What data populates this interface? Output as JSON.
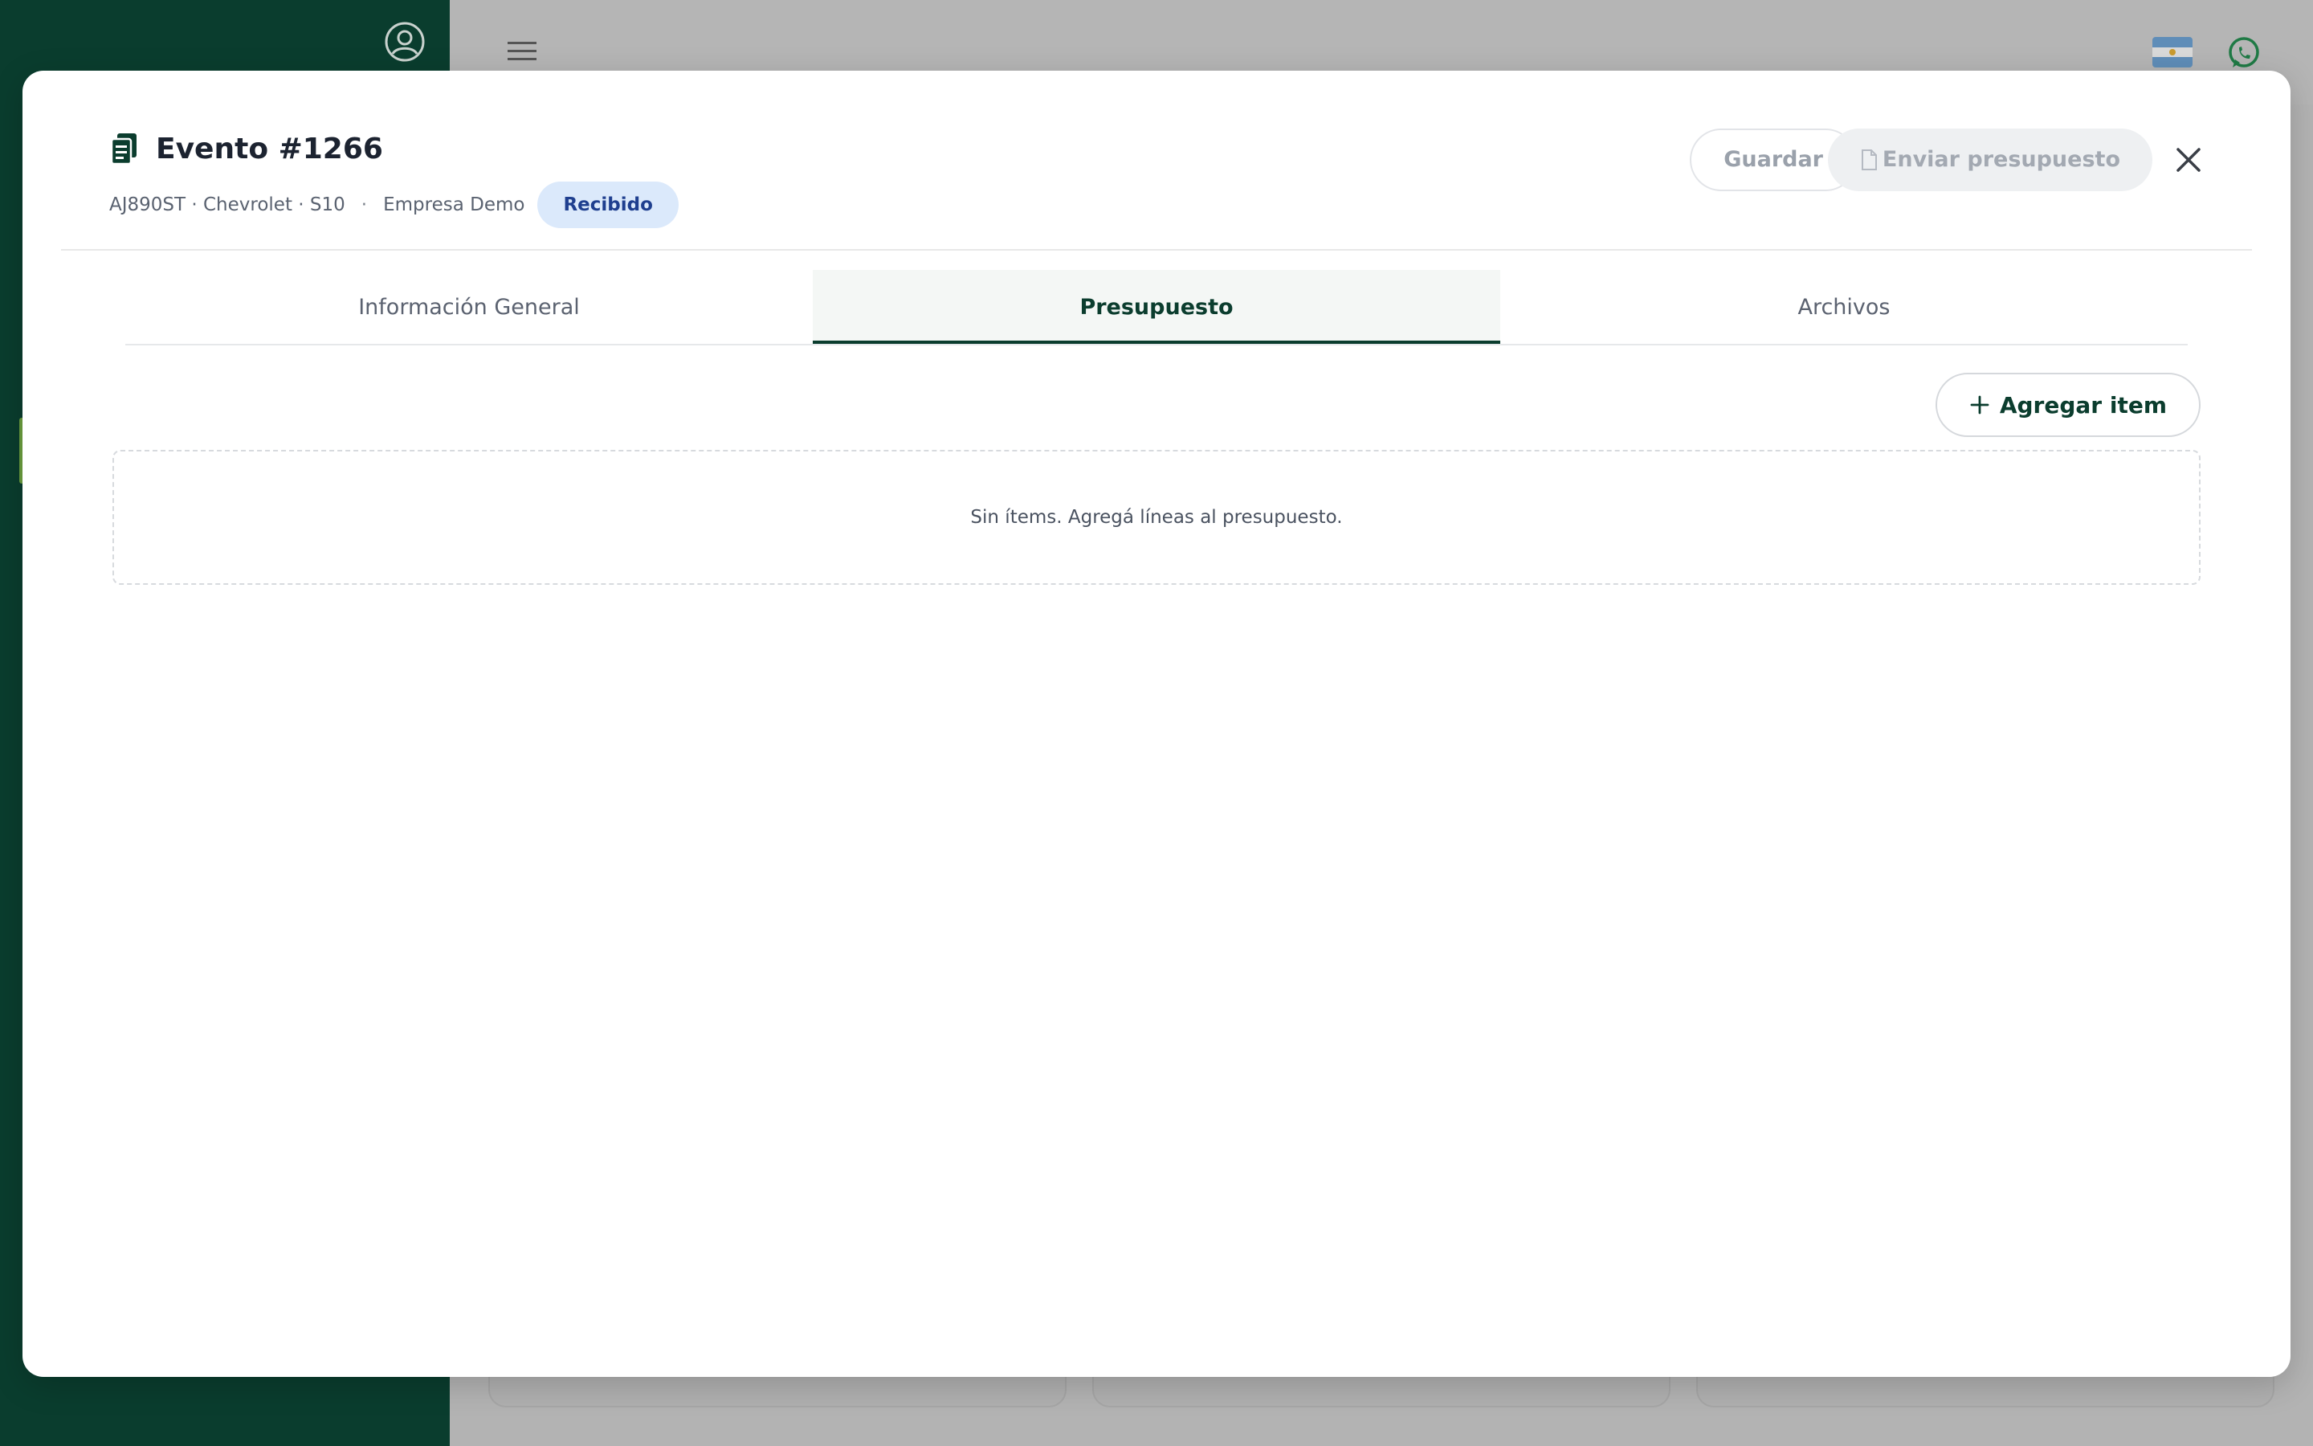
{
  "modal": {
    "title": "Evento #1266",
    "vehicle": "AJ890ST · Chevrolet · S10",
    "separator": "·",
    "company": "Empresa Demo",
    "status": "Recibido",
    "save_label": "Guardar",
    "send_label": "Enviar presupuesto"
  },
  "tabs": [
    {
      "label": "Información General",
      "active": false
    },
    {
      "label": "Presupuesto",
      "active": true
    },
    {
      "label": "Archivos",
      "active": false
    }
  ],
  "budget": {
    "add_item_label": "Agregar item",
    "empty_message": "Sin ítems. Agregá líneas al presupuesto."
  },
  "colors": {
    "brand_dark": "#0b3d2e",
    "sidebar_bg": "#0a3d2e",
    "badge_bg": "#dbe9fb",
    "badge_text": "#1f3f8f",
    "whatsapp": "#1f9d55"
  },
  "icons": {
    "title": "document-copy-icon",
    "close": "close-icon",
    "add": "plus-icon",
    "send": "file-icon",
    "profile": "user-circle-icon",
    "menu": "hamburger-menu-icon",
    "language": "argentina-flag-icon",
    "chat": "whatsapp-icon"
  }
}
